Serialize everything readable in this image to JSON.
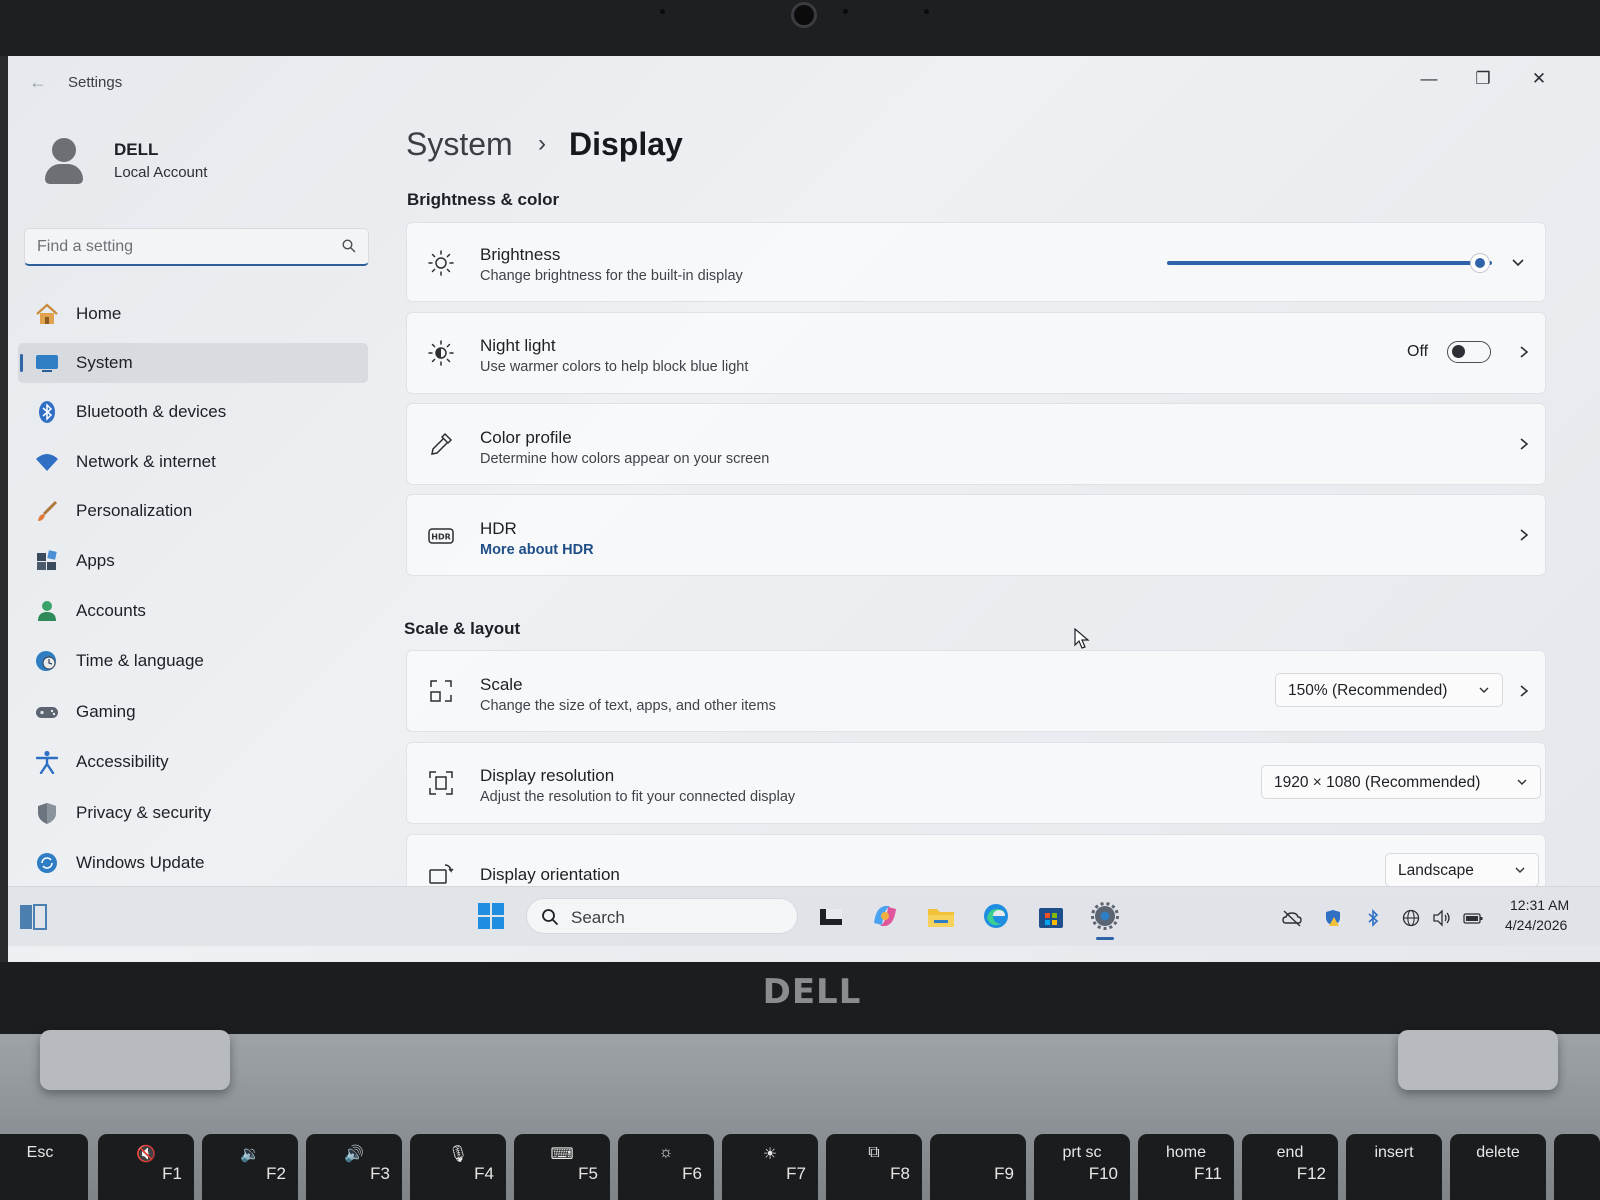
{
  "window": {
    "title": "Settings",
    "controls": {
      "minimize": "—",
      "maximize": "❐",
      "close": "✕"
    }
  },
  "account": {
    "name": "DELL",
    "type": "Local Account"
  },
  "search": {
    "placeholder": "Find a setting"
  },
  "nav": {
    "items": [
      {
        "label": "Home",
        "icon": "home-icon"
      },
      {
        "label": "System",
        "icon": "system-icon",
        "active": true
      },
      {
        "label": "Bluetooth & devices",
        "icon": "bluetooth-icon"
      },
      {
        "label": "Network & internet",
        "icon": "wifi-icon"
      },
      {
        "label": "Personalization",
        "icon": "brush-icon"
      },
      {
        "label": "Apps",
        "icon": "apps-icon"
      },
      {
        "label": "Accounts",
        "icon": "accounts-icon"
      },
      {
        "label": "Time & language",
        "icon": "globe-clock-icon"
      },
      {
        "label": "Gaming",
        "icon": "gamepad-icon"
      },
      {
        "label": "Accessibility",
        "icon": "accessibility-icon"
      },
      {
        "label": "Privacy & security",
        "icon": "shield-icon"
      },
      {
        "label": "Windows Update",
        "icon": "update-icon"
      }
    ]
  },
  "breadcrumb": {
    "parent": "System",
    "separator": "›",
    "current": "Display"
  },
  "sections": {
    "brightness_color": {
      "title": "Brightness & color",
      "brightness": {
        "title": "Brightness",
        "subtitle": "Change brightness for the built-in display",
        "level": 0.97
      },
      "night_light": {
        "title": "Night light",
        "subtitle": "Use warmer colors to help block blue light",
        "state": "Off"
      },
      "color_profile": {
        "title": "Color profile",
        "subtitle": "Determine how colors appear on your screen"
      },
      "hdr": {
        "title": "HDR",
        "link": "More about HDR"
      }
    },
    "scale_layout": {
      "title": "Scale & layout",
      "scale": {
        "title": "Scale",
        "subtitle": "Change the size of text, apps, and other items",
        "value": "150% (Recommended)"
      },
      "resolution": {
        "title": "Display resolution",
        "subtitle": "Adjust the resolution to fit your connected display",
        "value": "1920 × 1080 (Recommended)"
      },
      "orientation": {
        "title": "Display orientation",
        "value": "Landscape"
      }
    }
  },
  "taskbar": {
    "search_label": "Search",
    "time": "12:31 AM",
    "date": "4/24/2026"
  },
  "hardware": {
    "logo": "DELL",
    "keys": [
      {
        "top": "Esc",
        "fn": ""
      },
      {
        "top": "🔇",
        "fn": "F1"
      },
      {
        "top": "🔉",
        "fn": "F2"
      },
      {
        "top": "🔊",
        "fn": "F3"
      },
      {
        "top": "🎙",
        "fn": "F4"
      },
      {
        "top": "⌨",
        "fn": "F5"
      },
      {
        "top": "☼",
        "fn": "F6"
      },
      {
        "top": "☀",
        "fn": "F7"
      },
      {
        "top": "⧉",
        "fn": "F8"
      },
      {
        "top": "",
        "fn": "F9"
      },
      {
        "top": "prt sc",
        "fn": "F10"
      },
      {
        "top": "home",
        "fn": "F11"
      },
      {
        "top": "end",
        "fn": "F12"
      },
      {
        "top": "insert",
        "fn": ""
      },
      {
        "top": "delete",
        "fn": ""
      }
    ]
  },
  "colors": {
    "accent": "#2f64a8",
    "text": "#1d2024",
    "link": "#1f4e86"
  }
}
